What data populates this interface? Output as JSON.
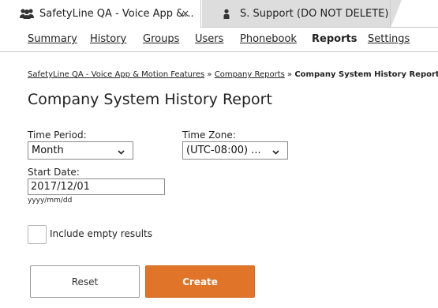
{
  "tabs": [
    {
      "label": "SafetyLine QA - Voice App &...",
      "icon": "people-group-icon",
      "active": true,
      "close": "×"
    },
    {
      "label": "S. Support (DO NOT DELETE)",
      "icon": "person-icon",
      "active": false
    }
  ],
  "nav": {
    "items": [
      "Summary",
      "History",
      "Groups",
      "Users",
      "Phonebook",
      "Reports",
      "Settings"
    ],
    "current": "Reports"
  },
  "breadcrumb": {
    "link1": "SafetyLine QA - Voice App & Motion Features",
    "sep1": " » ",
    "link2": "Company Reports",
    "sep2": " » ",
    "current": "Company System History Report"
  },
  "page_title": "Company System History Report",
  "form": {
    "time_period_label": "Time Period:",
    "time_period_value": "Month",
    "time_zone_label": "Time Zone:",
    "time_zone_value": "(UTC-08:00) ...",
    "start_date_label": "Start Date:",
    "start_date_value": "2017/12/01",
    "date_hint": "yyyy/mm/dd",
    "include_empty_label": "Include empty results",
    "include_empty_checked": false
  },
  "buttons": {
    "reset": "Reset",
    "create": "Create"
  },
  "colors": {
    "accent": "#e07428",
    "inactive_tab": "#dddddd",
    "border": "#c9c9c9"
  }
}
